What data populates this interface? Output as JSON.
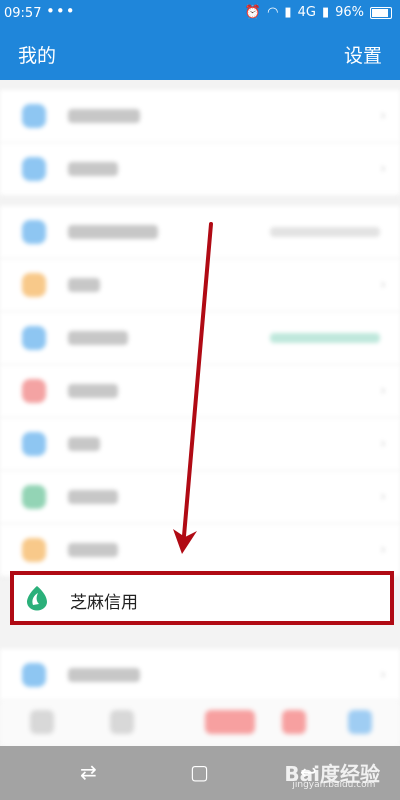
{
  "status_bar": {
    "time": "09:57",
    "dots": "•••",
    "network": "4G",
    "battery": "96%"
  },
  "header": {
    "title": "我的",
    "settings_label": "设置"
  },
  "highlighted_item": {
    "label": "芝麻信用",
    "icon": "sesame-credit-icon"
  },
  "watermark": {
    "brand": "Bai度经验",
    "site": "jingyan.baidu.com"
  },
  "colors": {
    "header_blue": "#1f86da",
    "highlight_red": "#b00a14",
    "arrow_red": "#b00a14"
  }
}
